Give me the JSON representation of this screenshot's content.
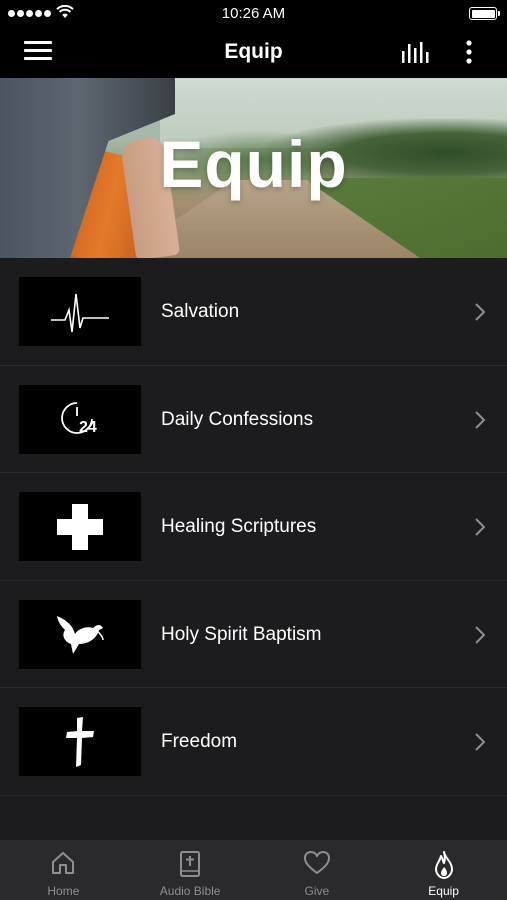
{
  "status_bar": {
    "time": "10:26 AM",
    "signal_bars": 5,
    "battery_level": 0.95
  },
  "nav": {
    "title": "Equip",
    "left_icon": "hamburger-menu-icon",
    "right_icons": [
      "equalizer-icon",
      "more-vertical-icon"
    ]
  },
  "hero": {
    "title": "Equip"
  },
  "list": {
    "items": [
      {
        "label": "Salvation",
        "icon": "heartbeat-icon"
      },
      {
        "label": "Daily Confessions",
        "icon": "clock-24-icon"
      },
      {
        "label": "Healing Scriptures",
        "icon": "medical-cross-icon"
      },
      {
        "label": "Holy Spirit Baptism",
        "icon": "dove-icon"
      },
      {
        "label": "Freedom",
        "icon": "cross-icon"
      }
    ]
  },
  "thumb_text": {
    "clock_number": "24"
  },
  "tab_bar": {
    "tabs": [
      {
        "label": "Home",
        "icon": "home-icon",
        "active": false
      },
      {
        "label": "Audio Bible",
        "icon": "bible-icon",
        "active": false
      },
      {
        "label": "Give",
        "icon": "heart-icon",
        "active": false
      },
      {
        "label": "Equip",
        "icon": "flame-icon",
        "active": true
      }
    ]
  },
  "colors": {
    "background": "#000000",
    "list_background": "#1c1c1e",
    "tab_bar_background": "#2a2a2c",
    "inactive_tab": "#8e8e93",
    "active_tab": "#ffffff"
  }
}
